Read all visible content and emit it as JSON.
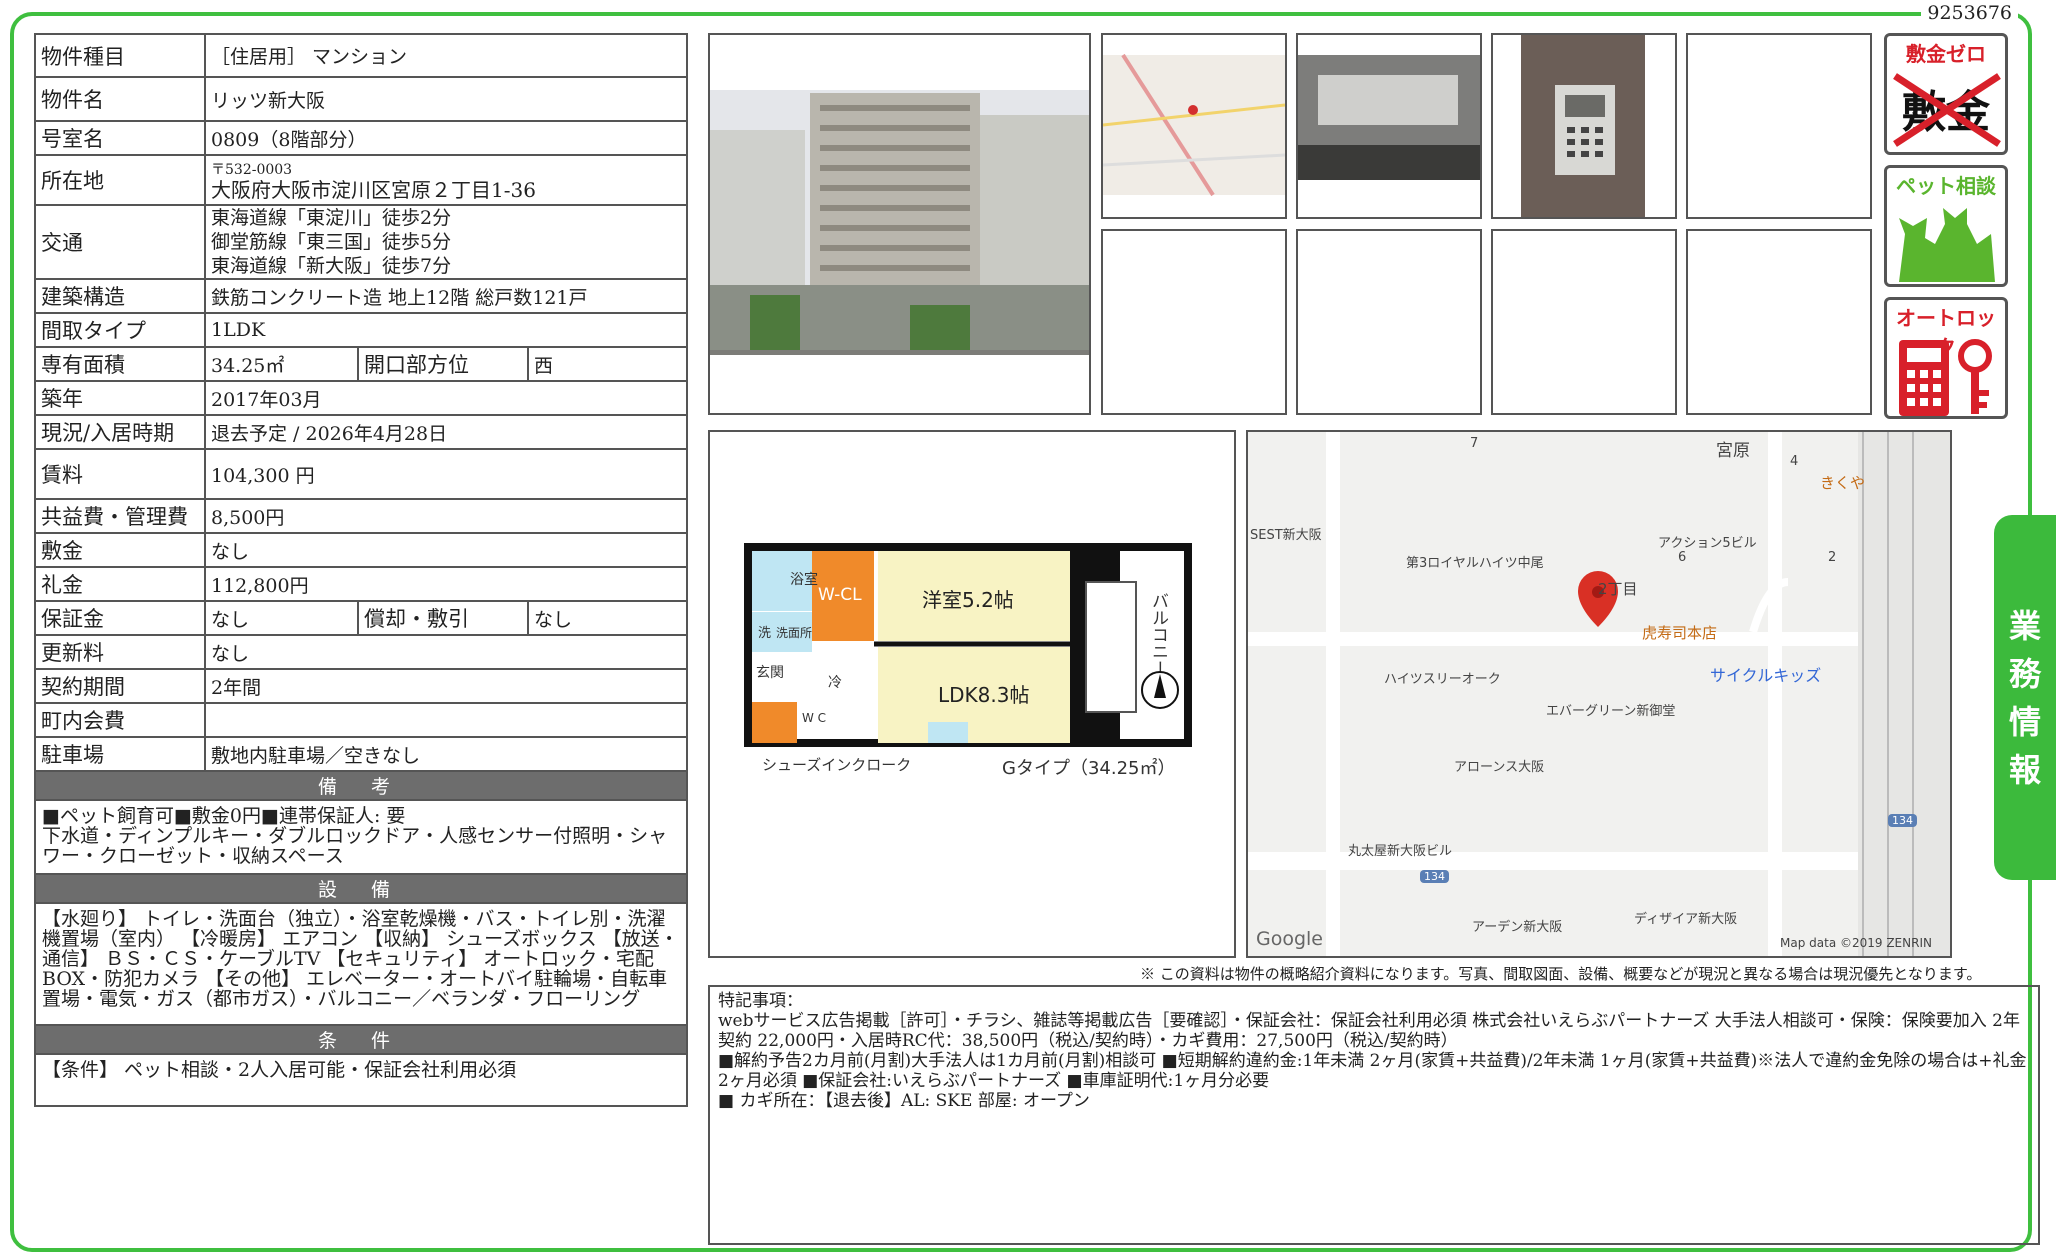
{
  "doc_number": "9253676",
  "spec": {
    "type_label": "物件種目",
    "type_value": "［住居用］ マンション",
    "name_label": "物件名",
    "name_value": "リッツ新大阪",
    "room_label": "号室名",
    "room_value": "0809（8階部分）",
    "address_label": "所在地",
    "postal": "〒532-0003",
    "address": "大阪府大阪市淀川区宮原２丁目1-36",
    "traffic_label": "交通",
    "traffic": [
      "東海道線「東淀川」徒歩2分",
      "御堂筋線「東三国」徒歩5分",
      "東海道線「新大阪」徒歩7分"
    ],
    "structure_label": "建築構造",
    "structure_value": "鉄筋コンクリート造 地上12階 総戸数121戸",
    "layout_label": "間取タイプ",
    "layout_value": "1LDK",
    "area_label": "専有面積",
    "area_value": "34.25㎡",
    "direction_label": "開口部方位",
    "direction_value": "西",
    "built_label": "築年",
    "built_value": "2017年03月",
    "status_label": "現況/入居時期",
    "status_value": "退去予定 / 2026年4月28日",
    "rent_label": "賃料",
    "rent_value": "104,300 円",
    "fee_label": "共益費・管理費",
    "fee_value": "8,500円",
    "deposit_label": "敷金",
    "deposit_value": "なし",
    "key_money_label": "礼金",
    "key_money_value": "112,800円",
    "guarantee_label": "保証金",
    "guarantee_value": "なし",
    "amort_label": "償却・敷引",
    "amort_value": "なし",
    "renewal_label": "更新料",
    "renewal_value": "なし",
    "contract_label": "契約期間",
    "contract_value": "2年間",
    "town_label": "町内会費",
    "town_value": "",
    "parking_label": "駐車場",
    "parking_value": "敷地内駐車場／空きなし"
  },
  "sections": {
    "remarks_title": "備 考",
    "remarks_text": "■ペット飼育可■敷金0円■連帯保証人: 要\n下水道・ディンプルキー・ダブルロックドア・人感センサー付照明・シャワー・クローゼット・収納スペース",
    "equipment_title": "設 備",
    "equipment_text": "【水廻り】 トイレ・洗面台（独立）・浴室乾燥機・バス・トイレ別・洗濯機置場（室内） 【冷暖房】 エアコン 【収納】 シューズボックス 【放送・通信】 ＢＳ・ＣＳ・ケーブルTV 【セキュリティ】 オートロック・宅配BOX・防犯カメラ 【その他】 エレベーター・オートバイ駐輪場・自転車置場・電気・ガス（都市ガス）・バルコニー／ベランダ・フローリング",
    "conditions_title": "条 件",
    "conditions_text": "【条件】 ペット相談・2人入居可能・保証会社利用必須"
  },
  "badges": [
    {
      "label": "敷金ゼロ",
      "sub": "敷金",
      "color": "#d8202a"
    },
    {
      "label": "ペット相談",
      "color": "#5ab52e"
    },
    {
      "label": "オートロック",
      "color": "#d8202a"
    }
  ],
  "sidetab": [
    "業",
    "務",
    "情",
    "報"
  ],
  "floorplan": {
    "bath": "浴室",
    "wcl": "W-CL",
    "room": "洋室5.2帖",
    "ldk": "LDK8.3帖",
    "wash": "洗",
    "washroom": "洗面所",
    "entry": "玄関",
    "fridge": "冷",
    "wc": "W\nC",
    "balcony": "バルコニー",
    "shoes": "シューズインクローク",
    "type": "Gタイプ（34.25㎡）"
  },
  "map": {
    "labels": [
      "宮原",
      "4",
      "7",
      "きくや",
      "SEST新大阪",
      "第3ロイヤルハイツ中尾",
      "アクション5ビル",
      "6",
      "2",
      "2丁目",
      "虎寿司本店",
      "ハイツスリーオーク",
      "サイクルキッズ",
      "エバーグリーン新御堂",
      "アローンス大阪",
      "丸太屋新大阪ビル",
      "134",
      "134",
      "ディザイア新大阪",
      "アーデン新大阪",
      "Google",
      "Map data ©2019 ZENRIN"
    ]
  },
  "disclaimer": "※ この資料は物件の概略紹介資料になります。写真、間取図面、設備、概要などが現況と異なる場合は現況優先となります。",
  "special": {
    "title": "特記事項：",
    "lines": [
      "webサービス広告掲載［許可］・チラシ、雑誌等掲載広告［要確認］・保証会社：保証会社利用必須 株式会社いえらぶパートナーズ 大手法人相談可・保険：保険要加入 2年契約 22,000円・入居時RC代：38,500円（税込/契約時）・カギ費用：27,500円（税込/契約時）",
      "■解約予告2カ月前(月割)大手法人は1カ月前(月割)相談可 ■短期解約違約金:1年未満 2ヶ月(家賃+共益費)/2年未満 1ヶ月(家賃+共益費)※法人で違約金免除の場合は+礼金2ヶ月必須 ■保証会社:いえらぶパートナーズ ■車庫証明代:1ヶ月分必要",
      "■ カギ所在：【退去後】AL: SKE 部屋: オープン"
    ]
  }
}
